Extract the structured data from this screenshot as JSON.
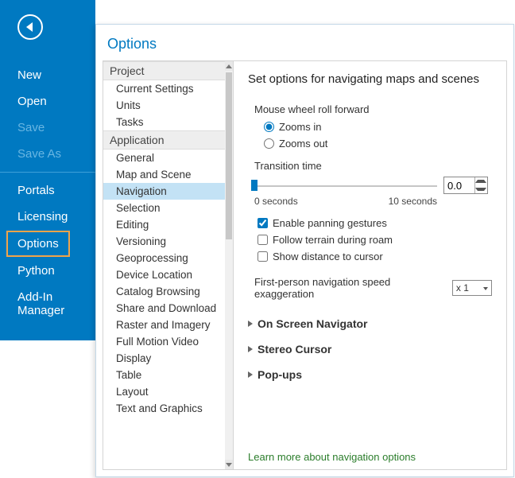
{
  "sidebar": {
    "items": [
      {
        "label": "New",
        "disabled": false
      },
      {
        "label": "Open",
        "disabled": false
      },
      {
        "label": "Save",
        "disabled": true
      },
      {
        "label": "Save As",
        "disabled": true
      }
    ],
    "items2": [
      {
        "label": "Portals"
      },
      {
        "label": "Licensing"
      },
      {
        "label": "Options",
        "highlight": true
      },
      {
        "label": "Python"
      },
      {
        "label": "Add-In Manager"
      }
    ]
  },
  "window": {
    "title": "Options",
    "groups": {
      "project": {
        "header": "Project",
        "items": [
          "Current Settings",
          "Units",
          "Tasks"
        ]
      },
      "application": {
        "header": "Application",
        "items": [
          "General",
          "Map and Scene",
          "Navigation",
          "Selection",
          "Editing",
          "Versioning",
          "Geoprocessing",
          "Device Location",
          "Catalog Browsing",
          "Share and Download",
          "Raster and Imagery",
          "Full Motion Video",
          "Display",
          "Table",
          "Layout",
          "Text and Graphics"
        ]
      }
    },
    "selected": "Navigation"
  },
  "content": {
    "heading": "Set options for navigating maps and scenes",
    "mouse_label": "Mouse wheel roll forward",
    "radio_in": "Zooms in",
    "radio_out": "Zooms out",
    "transition_label": "Transition time",
    "slider_min_label": "0 seconds",
    "slider_max_label": "10 seconds",
    "transition_value": "0.0",
    "check_panning": "Enable panning gestures",
    "check_terrain": "Follow terrain during roam",
    "check_distance": "Show distance to cursor",
    "speed_label": "First-person navigation speed exaggeration",
    "speed_value": "x 1",
    "expanders": [
      "On Screen Navigator",
      "Stereo Cursor",
      "Pop-ups"
    ],
    "learn_more": "Learn more about navigation options"
  }
}
